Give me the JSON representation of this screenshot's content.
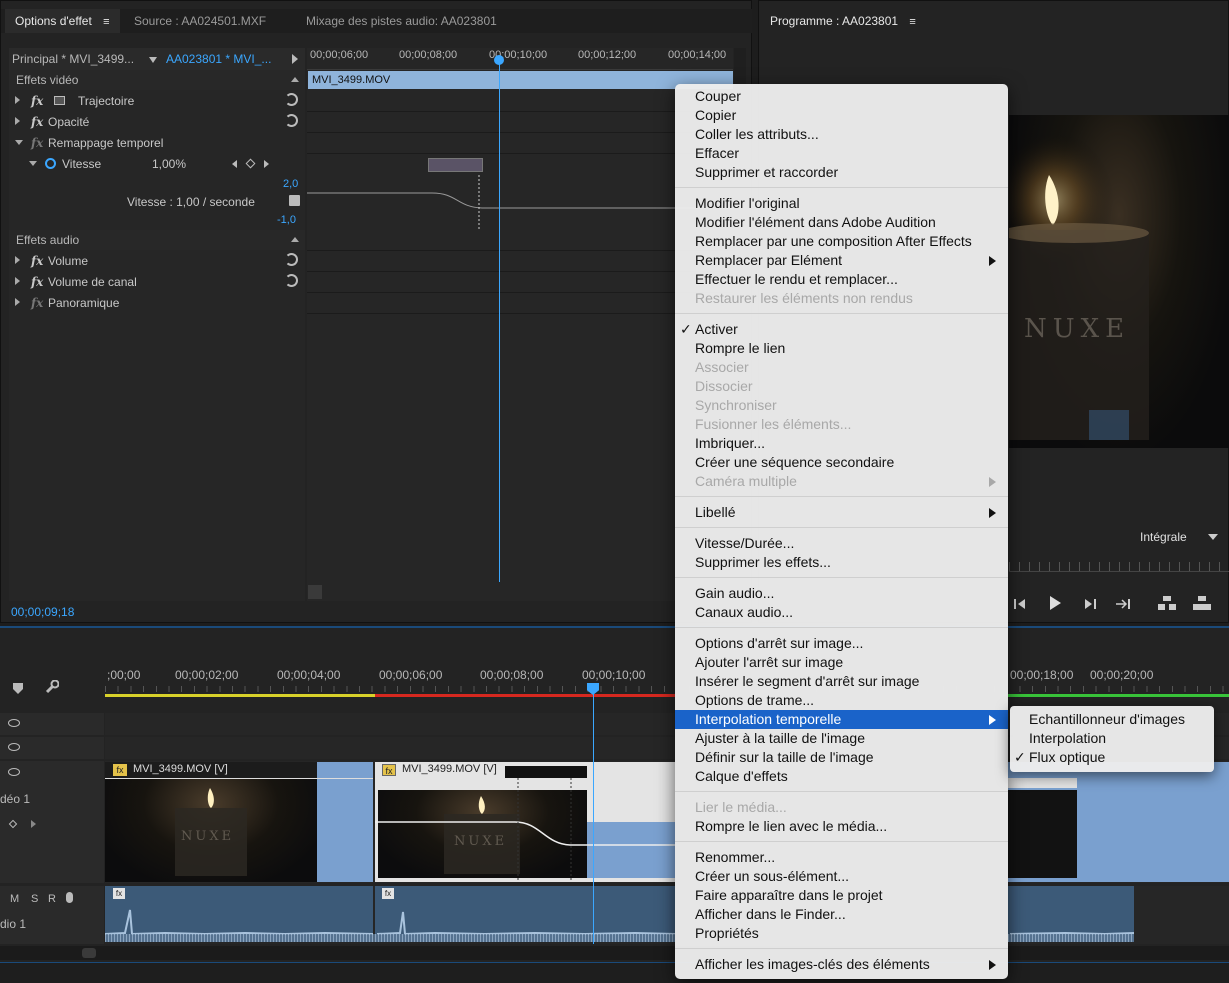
{
  "effect_panel": {
    "tabs": [
      "Options d'effet",
      "Source : AA024501.MXF",
      "Mixage des pistes audio: AA023801"
    ],
    "menu_glyph": "≡",
    "sequence_left": "Principal * MVI_3499...",
    "sequence_right": "AA023801 * MVI_...",
    "ruler": [
      "00;00;06;00",
      "00;00;08;00",
      "00;00;10;00",
      "00;00;12;00",
      "00;00;14;00"
    ],
    "clip_label": "MVI_3499.MOV",
    "video_header": "Effets vidéo",
    "audio_header": "Effets audio",
    "video_effects": [
      "Trajectoire",
      "Opacité",
      "Remappage temporel"
    ],
    "speed": {
      "label": "Vitesse",
      "value": "1,00%",
      "max": "2,0",
      "min": "-1,0",
      "rate": "Vitesse : 1,00 / seconde"
    },
    "audio_effects": [
      "Volume",
      "Volume de canal",
      "Panoramique"
    ],
    "timecode": "00;00;09;18"
  },
  "program": {
    "title": "Programme : AA023801",
    "menu_glyph": "≡",
    "zoom": "Intégrale",
    "watermark": "NUXE"
  },
  "timeline": {
    "ruler": [
      ";00;00",
      "00;00;02;00",
      "00;00;04;00",
      "00;00;06;00",
      "00;00;08;00",
      "00;00;10;00",
      "00;00;18;00",
      "00;00;20;00"
    ],
    "track_video": "déo 1",
    "track_audio": "dio 1",
    "msr": [
      "M",
      "S",
      "R"
    ],
    "clip1": "MVI_3499.MOV [V]",
    "clip2": "MVI_3499.MOV [V]",
    "fx": "fx"
  },
  "context_menu": {
    "groups": [
      [
        {
          "label": "Couper"
        },
        {
          "label": "Copier"
        },
        {
          "label": "Coller les attributs..."
        },
        {
          "label": "Effacer"
        },
        {
          "label": "Supprimer et raccorder"
        }
      ],
      [
        {
          "label": "Modifier l'original"
        },
        {
          "label": "Modifier l'élément dans Adobe Audition"
        },
        {
          "label": "Remplacer par une composition After Effects"
        },
        {
          "label": "Remplacer par Elément",
          "sub": true
        },
        {
          "label": "Effectuer le rendu et remplacer..."
        },
        {
          "label": "Restaurer les éléments non rendus",
          "disabled": true
        }
      ],
      [
        {
          "label": "Activer",
          "checked": true
        },
        {
          "label": "Rompre le lien"
        },
        {
          "label": "Associer",
          "disabled": true
        },
        {
          "label": "Dissocier",
          "disabled": true
        },
        {
          "label": "Synchroniser",
          "disabled": true
        },
        {
          "label": "Fusionner les éléments...",
          "disabled": true
        },
        {
          "label": "Imbriquer..."
        },
        {
          "label": "Créer une séquence secondaire"
        },
        {
          "label": "Caméra multiple",
          "disabled": true,
          "sub": true
        }
      ],
      [
        {
          "label": "Libellé",
          "sub": true
        }
      ],
      [
        {
          "label": "Vitesse/Durée..."
        },
        {
          "label": "Supprimer les effets..."
        }
      ],
      [
        {
          "label": "Gain audio..."
        },
        {
          "label": "Canaux audio..."
        }
      ],
      [
        {
          "label": "Options d'arrêt sur image..."
        },
        {
          "label": "Ajouter l'arrêt sur image"
        },
        {
          "label": "Insérer le segment d'arrêt sur image"
        },
        {
          "label": "Options de trame..."
        },
        {
          "label": "Interpolation temporelle",
          "sub": true,
          "selected": true
        },
        {
          "label": "Ajuster à la taille de l'image"
        },
        {
          "label": "Définir sur la taille de l'image"
        },
        {
          "label": "Calque d'effets"
        }
      ],
      [
        {
          "label": "Lier le média...",
          "disabled": true
        },
        {
          "label": "Rompre le lien avec le média..."
        }
      ],
      [
        {
          "label": "Renommer..."
        },
        {
          "label": "Créer un sous-élément..."
        },
        {
          "label": "Faire apparaître dans le projet"
        },
        {
          "label": "Afficher dans le Finder..."
        },
        {
          "label": "Propriétés"
        }
      ],
      [
        {
          "label": "Afficher les images-clés des éléments",
          "sub": true
        }
      ]
    ],
    "check_glyph": "✓"
  },
  "submenu": {
    "items": [
      {
        "label": "Echantillonneur d'images"
      },
      {
        "label": "Interpolation"
      },
      {
        "label": "Flux optique",
        "checked": true
      }
    ]
  }
}
